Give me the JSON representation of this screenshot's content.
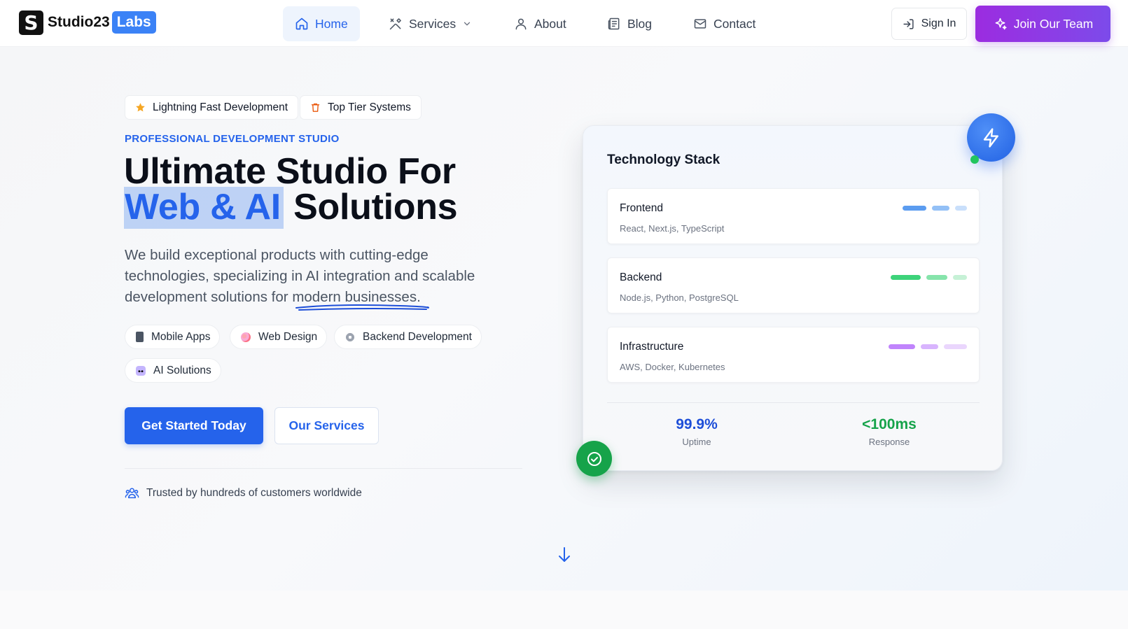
{
  "brand": {
    "mark": "S",
    "name": "Studio23",
    "badge": "Labs"
  },
  "nav": {
    "home": "Home",
    "services": "Services",
    "about": "About",
    "blog": "Blog",
    "contact": "Contact"
  },
  "actions": {
    "sign_in": "Sign In",
    "join": "Join Our Team"
  },
  "hero": {
    "chips": [
      "Lightning Fast Development",
      "Top Tier Systems"
    ],
    "eyebrow": "PROFESSIONAL DEVELOPMENT STUDIO",
    "headline_line1": "Ultimate Studio For",
    "headline_highlight": "Web & AI",
    "headline_line2_rest": "Solutions",
    "lead_before": "We build exceptional products with cutting-edge technologies, specializing in AI integration and scalable development solutions for ",
    "lead_underlined": "modern businesses",
    "lead_after": ".",
    "tags": [
      "Mobile Apps",
      "Web Design",
      "Backend Development",
      "AI Solutions"
    ],
    "cta_primary": "Get Started Today",
    "cta_secondary": "Our Services",
    "trusted": "Trusted by hundreds of customers worldwide"
  },
  "tech_card": {
    "title": "Technology Stack",
    "rows": [
      {
        "name": "Frontend",
        "tech": "React, Next.js, TypeScript",
        "colors": [
          "#5b9cf0",
          "#93c0f6",
          "#c9dffb"
        ]
      },
      {
        "name": "Backend",
        "tech": "Node.js, Python, PostgreSQL",
        "colors": [
          "#3dd37a",
          "#86e4ab",
          "#c6f1d6"
        ]
      },
      {
        "name": "Infrastructure",
        "tech": "AWS, Docker, Kubernetes",
        "colors": [
          "#c084fc",
          "#d8b4fe",
          "#ead6fd"
        ]
      }
    ],
    "metrics": [
      {
        "value": "99.9%",
        "label": "Uptime",
        "color": "#1d4ed8"
      },
      {
        "value": "<100ms",
        "label": "Response",
        "color": "#16a34a"
      }
    ]
  },
  "colors": {
    "accent": "#2563eb",
    "join_gradient_start": "#9b2ce0",
    "success": "#16a34a"
  }
}
